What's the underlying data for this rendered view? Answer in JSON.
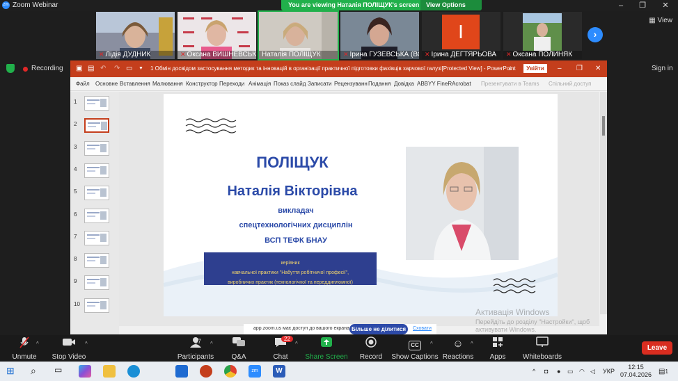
{
  "zoom": {
    "window_title": "Zoom Webinar",
    "banner_text": "You are viewing Наталія ПОЛІЩУК's screen",
    "view_options_label": "View Options",
    "view_label": "View",
    "recording_label": "Recording",
    "sign_in_label": "Sign in"
  },
  "participants": [
    {
      "name": "Лідія ДУДНИК"
    },
    {
      "name": "Оксана ВИШНЕВСЬКА"
    },
    {
      "name": "Наталія ПОЛІЩУК"
    },
    {
      "name": "Ірина ГУЗЕВСЬКА (ВС..."
    },
    {
      "name": "Ірина ДЕГТЯРЬОВА"
    },
    {
      "name": "Оксана ПОЛИНЯК"
    }
  ],
  "tile_initial": "I",
  "powerpoint": {
    "doc_title": "1 Обмін досвідом застосування методик та інновацій в організації практичної підготовки фахівців харчової галузі[Protected View] - PowerPoint",
    "sign_in_button": "Увійти",
    "ribbon_tabs": [
      "Файл",
      "Основне",
      "Вставлення",
      "Малювання",
      "Конструктор",
      "Переходи",
      "Анімація",
      "Показ слайд",
      "Записати",
      "Рецензуванн",
      "Подання",
      "Довідка",
      "ABBYY FineR",
      "Acrobat"
    ],
    "ribbon_disabled": [
      "Презентувати в Teams",
      "Спільний доступ"
    ],
    "slide_numbers": [
      "1",
      "2",
      "3",
      "4",
      "5",
      "6",
      "7",
      "8",
      "9",
      "10"
    ],
    "active_slide": 2
  },
  "slide": {
    "surname": "ПОЛІЩУК",
    "fullname": "Наталія Вікторівна",
    "line1": "викладач",
    "line2": "спецтехнологічних дисциплін",
    "line3": "ВСП ТЕФК БНАУ",
    "role1": "керівник",
    "role2": "навчальної практики \"Набуття робітничої професії\",",
    "role3": "виробничих практик (технологічної та переддипломної)"
  },
  "share_bar": {
    "text": "app.zoom.us має доступ до вашого екрана.",
    "stop_button": "Більше не ділитися",
    "hide_link": "Сховати"
  },
  "activation": {
    "title": "Активація Windows",
    "text": "Перейдіть до розділу \"Настройки\", щоб активувати Windows."
  },
  "toolbar": {
    "unmute": "Unmute",
    "stop_video": "Stop Video",
    "participants": "Participants",
    "participants_count": "57",
    "qa": "Q&A",
    "chat": "Chat",
    "chat_badge": "22",
    "share_screen": "Share Screen",
    "record": "Record",
    "show_captions": "Show Captions",
    "cc": "CC",
    "reactions": "Reactions",
    "apps": "Apps",
    "whiteboards": "Whiteboards",
    "leave": "Leave"
  },
  "taskbar": {
    "lang": "УКР",
    "time": "12:15",
    "date": "07.04.2026",
    "notifications": "1"
  },
  "colors": {
    "zoom_green": "#21b04b",
    "zoom_blue": "#2d8cff",
    "ppt_red": "#c43e1c",
    "leave_red": "#d92d20",
    "slide_blue": "#2b4aa8"
  }
}
